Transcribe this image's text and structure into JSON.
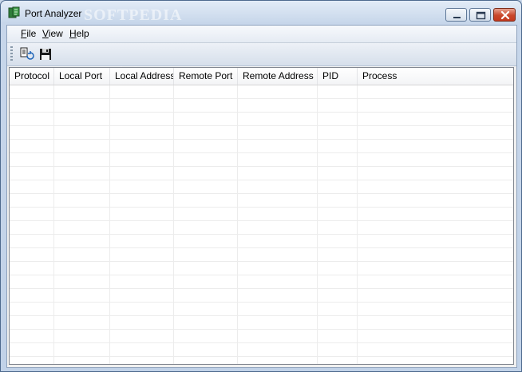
{
  "window": {
    "title": "Port Analyzer",
    "watermark": "SOFTPEDIA",
    "watermark_url": "www.softpedia.com"
  },
  "menu": [
    {
      "label": "File",
      "accel": "F",
      "rest": "ile"
    },
    {
      "label": "View",
      "accel": "V",
      "rest": "iew"
    },
    {
      "label": "Help",
      "accel": "H",
      "rest": "elp"
    }
  ],
  "toolbar": {
    "buttons": [
      {
        "name": "refresh-connections-icon"
      },
      {
        "name": "save-icon"
      }
    ]
  },
  "table": {
    "columns": [
      "Protocol",
      "Local Port",
      "Local Address",
      "Remote Port",
      "Remote Address",
      "PID",
      "Process"
    ],
    "rows": []
  },
  "colors": {
    "titlebar": "#c9d7ea",
    "close_button": "#c43a1f",
    "grid_line": "#ececec"
  }
}
